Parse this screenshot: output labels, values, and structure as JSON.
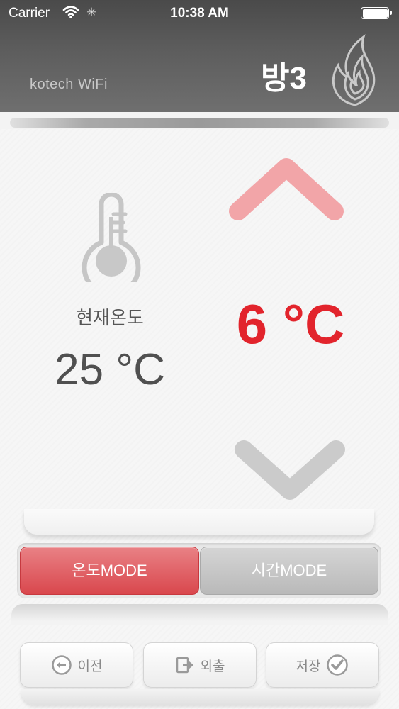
{
  "status_bar": {
    "carrier": "Carrier",
    "time": "10:38 AM",
    "icons": [
      "wifi-icon",
      "activity-spinner-icon",
      "battery-icon"
    ]
  },
  "header": {
    "brand": "kotech WiFi",
    "room_title": "방3",
    "logo_icon": "flame-icon"
  },
  "current": {
    "label": "현재온도",
    "value": "25 °C",
    "icon": "thermometer-icon"
  },
  "setpoint": {
    "value": "6 °C",
    "up_icon": "chevron-up-icon",
    "down_icon": "chevron-down-icon"
  },
  "modes": {
    "temp_label": "온도MODE",
    "time_label": "시간MODE",
    "active": "temp"
  },
  "actions": {
    "prev_label": "이전",
    "out_label": "외출",
    "save_label": "저장"
  },
  "colors": {
    "accent": "#e2242c",
    "active_mode": "#d9474d",
    "inactive_mode": "#bdbdbd",
    "header": "#5d5d5d"
  }
}
